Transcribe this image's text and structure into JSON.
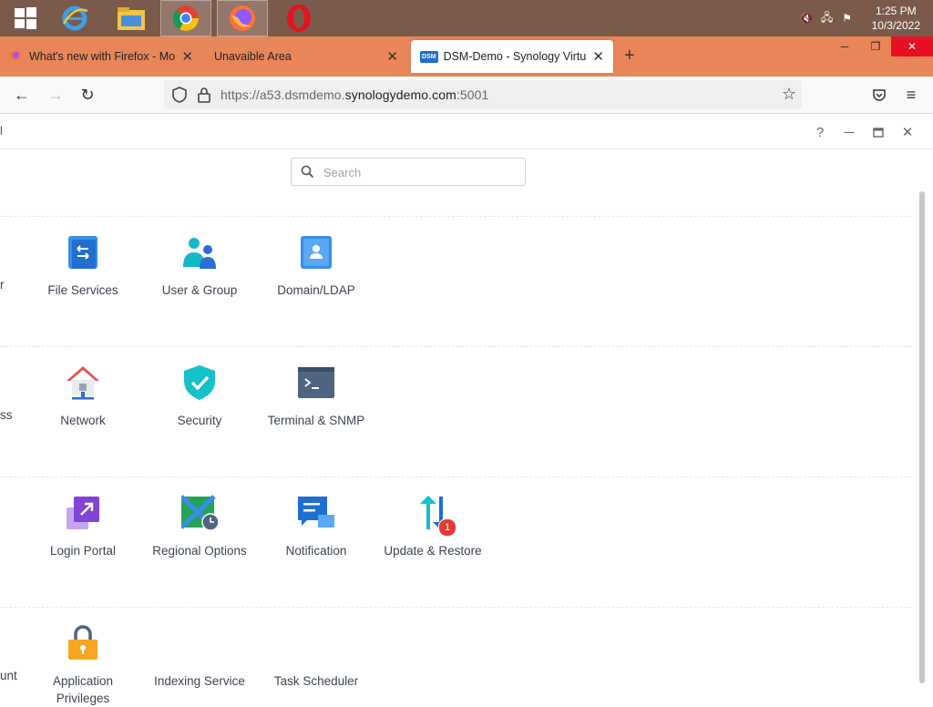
{
  "taskbar": {
    "apps": [
      "windows-start",
      "internet-explorer",
      "file-explorer",
      "chrome",
      "firefox",
      "opera"
    ],
    "clock_time": "1:25 PM",
    "clock_date": "10/3/2022"
  },
  "browser": {
    "tabs": [
      {
        "title": "What's new with Firefox - More"
      },
      {
        "title": "Unavaible Area"
      },
      {
        "title": "DSM-Demo - Synology VirtualD",
        "favicon_text": "DSM"
      }
    ],
    "url_prefix": "https://a53.dsmdemo.",
    "url_domain": "synologydemo.com",
    "url_suffix": ":5001"
  },
  "dsm": {
    "title_partial": "l",
    "search_placeholder": "Search",
    "rows": [
      {
        "partial": "r",
        "items": [
          {
            "label": "File Services",
            "icon": "file-services-icon"
          },
          {
            "label": "User & Group",
            "icon": "user-group-icon"
          },
          {
            "label": "Domain/LDAP",
            "icon": "domain-ldap-icon"
          }
        ]
      },
      {
        "partial": "ss",
        "items": [
          {
            "label": "Network",
            "icon": "network-icon"
          },
          {
            "label": "Security",
            "icon": "security-icon"
          },
          {
            "label": "Terminal & SNMP",
            "icon": "terminal-icon"
          }
        ]
      },
      {
        "partial": "",
        "items": [
          {
            "label": "Login Portal",
            "icon": "login-portal-icon"
          },
          {
            "label": "Regional Options",
            "icon": "regional-options-icon"
          },
          {
            "label": "Notification",
            "icon": "notification-icon"
          },
          {
            "label": "Update & Restore",
            "icon": "update-restore-icon",
            "badge": "1"
          }
        ]
      },
      {
        "partial": "unt",
        "items": [
          {
            "label": "Application Privileges",
            "icon": "application-privileges-icon"
          },
          {
            "label": "Indexing Service",
            "icon": "indexing-service-icon"
          },
          {
            "label": "Task Scheduler",
            "icon": "task-scheduler-icon"
          }
        ]
      }
    ]
  }
}
